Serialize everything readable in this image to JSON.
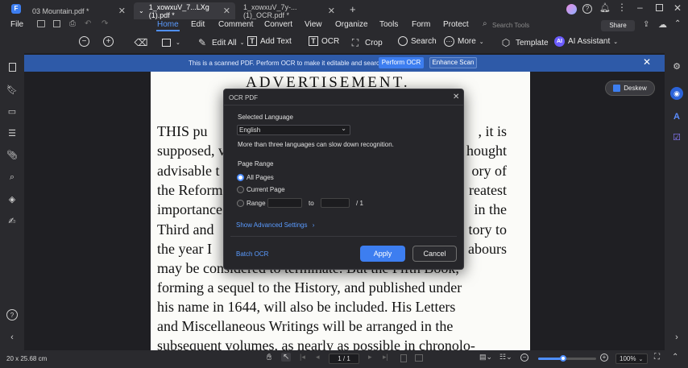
{
  "tabs": [
    {
      "label": "03 Mountain.pdf *",
      "active": false
    },
    {
      "label": "1_xowxuV_7...LXg (1).pdf *",
      "active": true
    },
    {
      "label": "1_xowxuV_7y-... (1)_OCR.pdf *",
      "active": false
    }
  ],
  "menu": {
    "file": "File",
    "items": [
      "Home",
      "Edit",
      "Comment",
      "Convert",
      "View",
      "Organize",
      "Tools",
      "Form",
      "Protect"
    ],
    "active": "Home",
    "search_placeholder": "Search Tools",
    "share": "Share"
  },
  "toolbar": {
    "edit_all": "Edit All",
    "add_text": "Add Text",
    "ocr": "OCR",
    "crop": "Crop",
    "search": "Search",
    "more": "More",
    "template": "Template",
    "ai_assistant": "AI Assistant",
    "ai_badge": "AI"
  },
  "banner": {
    "message": "This is a scanned PDF. Perform OCR to make it editable and searchable.",
    "perform_ocr": "Perform OCR",
    "enhance_scan": "Enhance Scan"
  },
  "deskew": "Deskew",
  "document": {
    "heading": "ADVERTISEMENT.",
    "lines": [
      [
        "THIS pu",
        ", it is"
      ],
      [
        "supposed, v",
        "hought"
      ],
      [
        "advisable t",
        "ory of"
      ],
      [
        "the Reform",
        "reatest"
      ],
      [
        "importance",
        "in the"
      ],
      [
        "Third and",
        "tory to"
      ],
      [
        "the year I",
        "abours"
      ],
      [
        "may be considered to terminate.  But the Fifth Book,",
        ""
      ],
      [
        "forming a sequel to the History, and published under",
        ""
      ],
      [
        "his name in 1644, will also be included.  His Letters",
        ""
      ],
      [
        "and Miscellaneous Writings will be arranged in the",
        ""
      ],
      [
        "subsequent volumes, as nearly as possible in chronolo-",
        ""
      ]
    ]
  },
  "dialog": {
    "title": "OCR PDF",
    "selected_language_label": "Selected Language",
    "language": "English",
    "language_note": "More than three languages can slow down recognition.",
    "page_range_label": "Page Range",
    "options": [
      "All Pages",
      "Current Page",
      "Range"
    ],
    "selected_option": "All Pages",
    "to_label": "to",
    "total_pages": "/ 1",
    "advanced": "Show Advanced Settings",
    "batch": "Batch OCR",
    "apply": "Apply",
    "cancel": "Cancel"
  },
  "status": {
    "page_size": "20 x 25.68 cm",
    "page_indicator": "1 / 1",
    "zoom": "100%",
    "zoom_fraction": 0.43
  },
  "colors": {
    "accent": "#4f8fff",
    "banner": "#2e5aa8",
    "apply_button": "#3d7ef0"
  }
}
